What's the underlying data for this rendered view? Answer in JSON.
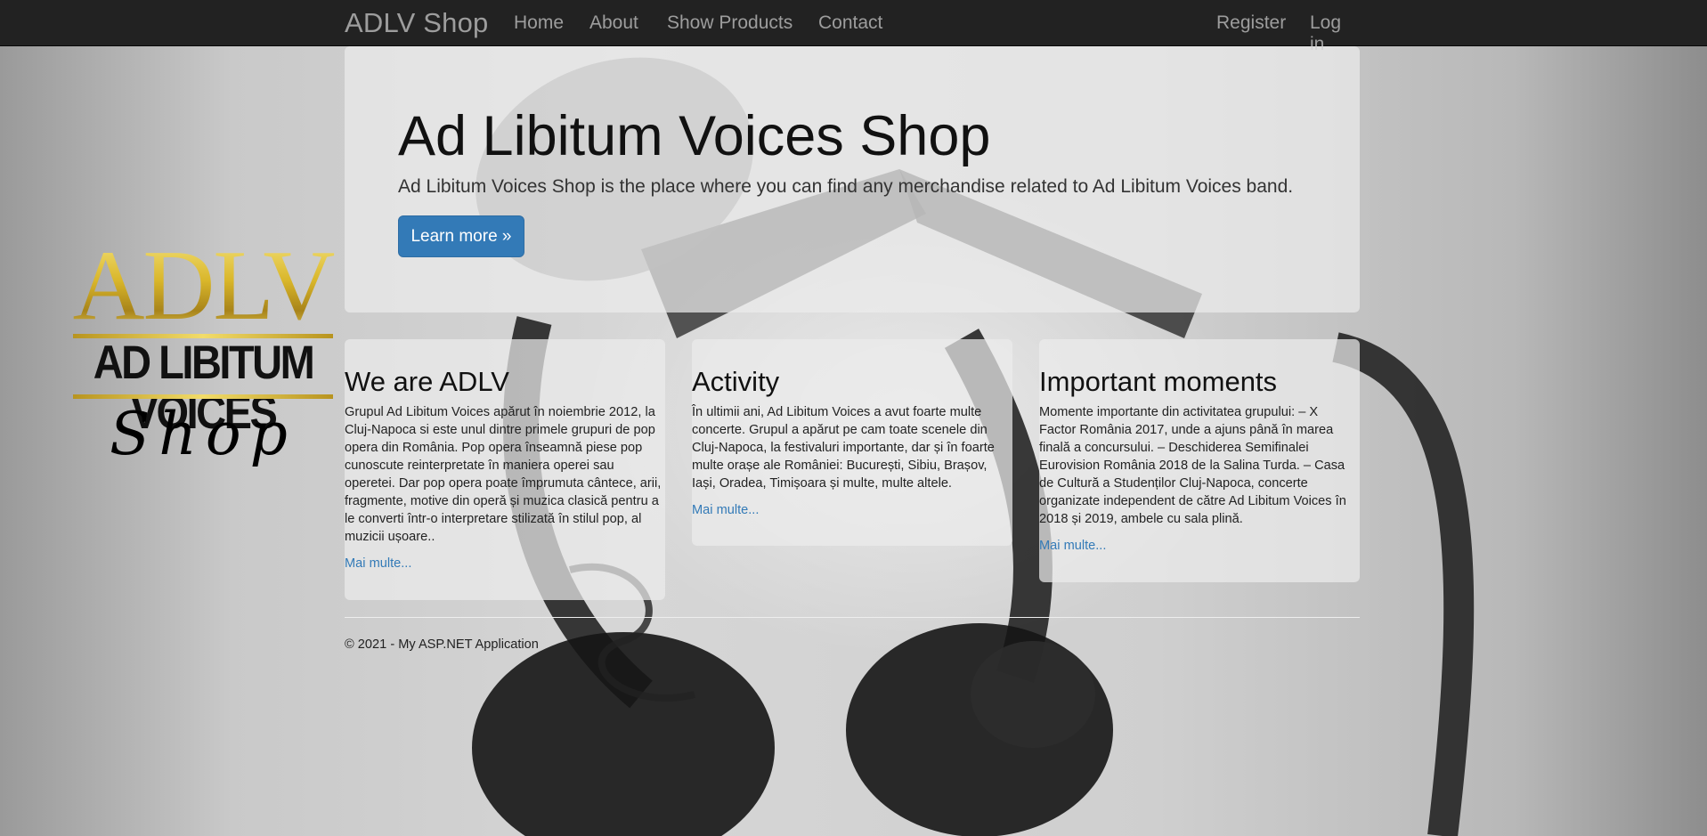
{
  "navbar": {
    "brand": "ADLV Shop",
    "links": [
      "Home",
      "About",
      "Show Products",
      "Contact"
    ],
    "register": "Register",
    "login": "Log in"
  },
  "logo": {
    "top_text": "ADLV",
    "middle_text": "AD LIBITUM VOICES",
    "bottom_text": "Shop"
  },
  "jumbotron": {
    "title": "Ad Libitum Voices Shop",
    "lead": "Ad Libitum Voices Shop is the place where you can find any merchandise related to Ad Libitum Voices band.",
    "button": "Learn more »"
  },
  "cards": [
    {
      "title": "We are ADLV",
      "text": "Grupul Ad Libitum Voices apărut în noiembrie 2012, la Cluj-Napoca si este unul dintre primele grupuri de pop opera din România. Pop opera înseamnă piese pop cunoscute reinterpretate în maniera operei sau operetei. Dar pop opera poate împrumuta cântece, arii, fragmente, motive din operă și muzica clasică pentru a le converti într-o interpretare stilizată în stilul pop, al muzicii ușoare..",
      "link": "Mai multe..."
    },
    {
      "title": "Activity",
      "text": "În ultimii ani, Ad Libitum Voices a avut foarte multe concerte. Grupul a apărut pe cam toate scenele din Cluj-Napoca, la festivaluri importante, dar și în foarte multe orașe ale României: București, Sibiu, Brașov, Iași, Oradea, Timișoara și multe, multe altele.",
      "link": "Mai multe..."
    },
    {
      "title": "Important moments",
      "text": "Momente importante din activitatea grupului: – X Factor România 2017, unde a ajuns până în marea finală a concursului. – Deschiderea Semifinalei Eurovision România 2018 de la Salina Turda. – Casa de Cultură a Studenților Cluj-Napoca, concerte organizate independent de către Ad Libitum Voices în 2018 și 2019, ambele cu sala plină.",
      "link": "Mai multe..."
    }
  ],
  "footer": {
    "text": "© 2021 - My ASP.NET Application"
  },
  "colors": {
    "navbar_bg": "#222222",
    "nav_text": "#9d9d9d",
    "primary": "#337ab7",
    "logo_gold": "#d9b62a"
  }
}
